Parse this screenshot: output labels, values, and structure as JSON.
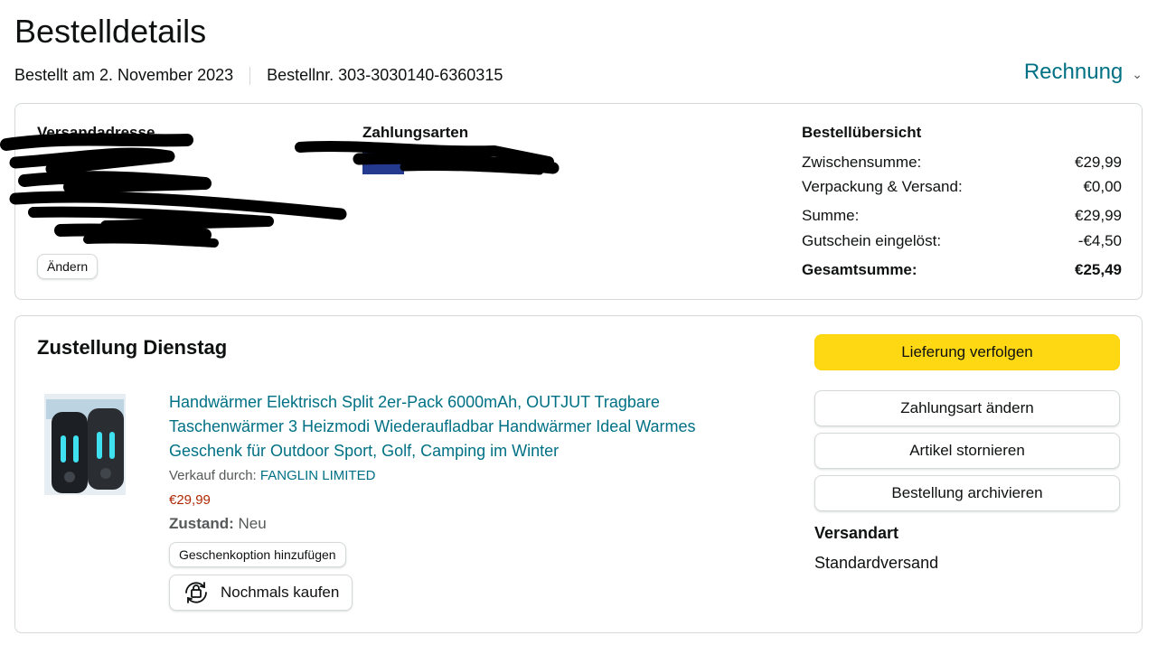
{
  "page": {
    "title": "Bestelldetails",
    "order_date": "Bestellt am 2. November 2023",
    "order_number": "Bestellnr. 303-3030140-6360315",
    "invoice_label": "Rechnung"
  },
  "summary": {
    "shipping_address_title": "Versandadresse",
    "change_label": "Ändern",
    "payment_title": "Zahlungsarten",
    "overview_title": "Bestellübersicht",
    "rows": [
      {
        "label": "Zwischensumme:",
        "value": "€29,99"
      },
      {
        "label": "Verpackung & Versand:",
        "value": "€0,00"
      },
      {
        "label": "Summe:",
        "value": "€29,99"
      },
      {
        "label": "Gutschein eingelöst:",
        "value": "-€4,50"
      }
    ],
    "total": {
      "label": "Gesamtsumme:",
      "value": "€25,49"
    }
  },
  "delivery": {
    "title": "Zustellung Dienstag",
    "product": {
      "title": "Handwärmer Elektrisch Split 2er-Pack 6000mAh, OUTJUT Tragbare Taschenwärmer 3 Heizmodi Wiederaufladbar Handwärmer Ideal Warmes Geschenk für Outdoor Sport, Golf, Camping im Winter",
      "sold_by_label": "Verkauf durch:",
      "seller": "FANGLIN LIMITED",
      "price": "€29,99",
      "condition_label": "Zustand:",
      "condition_value": "Neu",
      "gift_label": "Geschenkoption hinzufügen",
      "rebuy_label": "Nochmals kaufen"
    },
    "actions": {
      "track": "Lieferung verfolgen",
      "change_payment": "Zahlungsart ändern",
      "cancel": "Artikel stornieren",
      "archive": "Bestellung archivieren"
    },
    "shipping_method_label": "Versandart",
    "shipping_method_value": "Standardversand"
  },
  "colors": {
    "link": "#007185",
    "primary_button": "#FFD814",
    "price": "#B12704",
    "border": "#D5D9D9"
  }
}
